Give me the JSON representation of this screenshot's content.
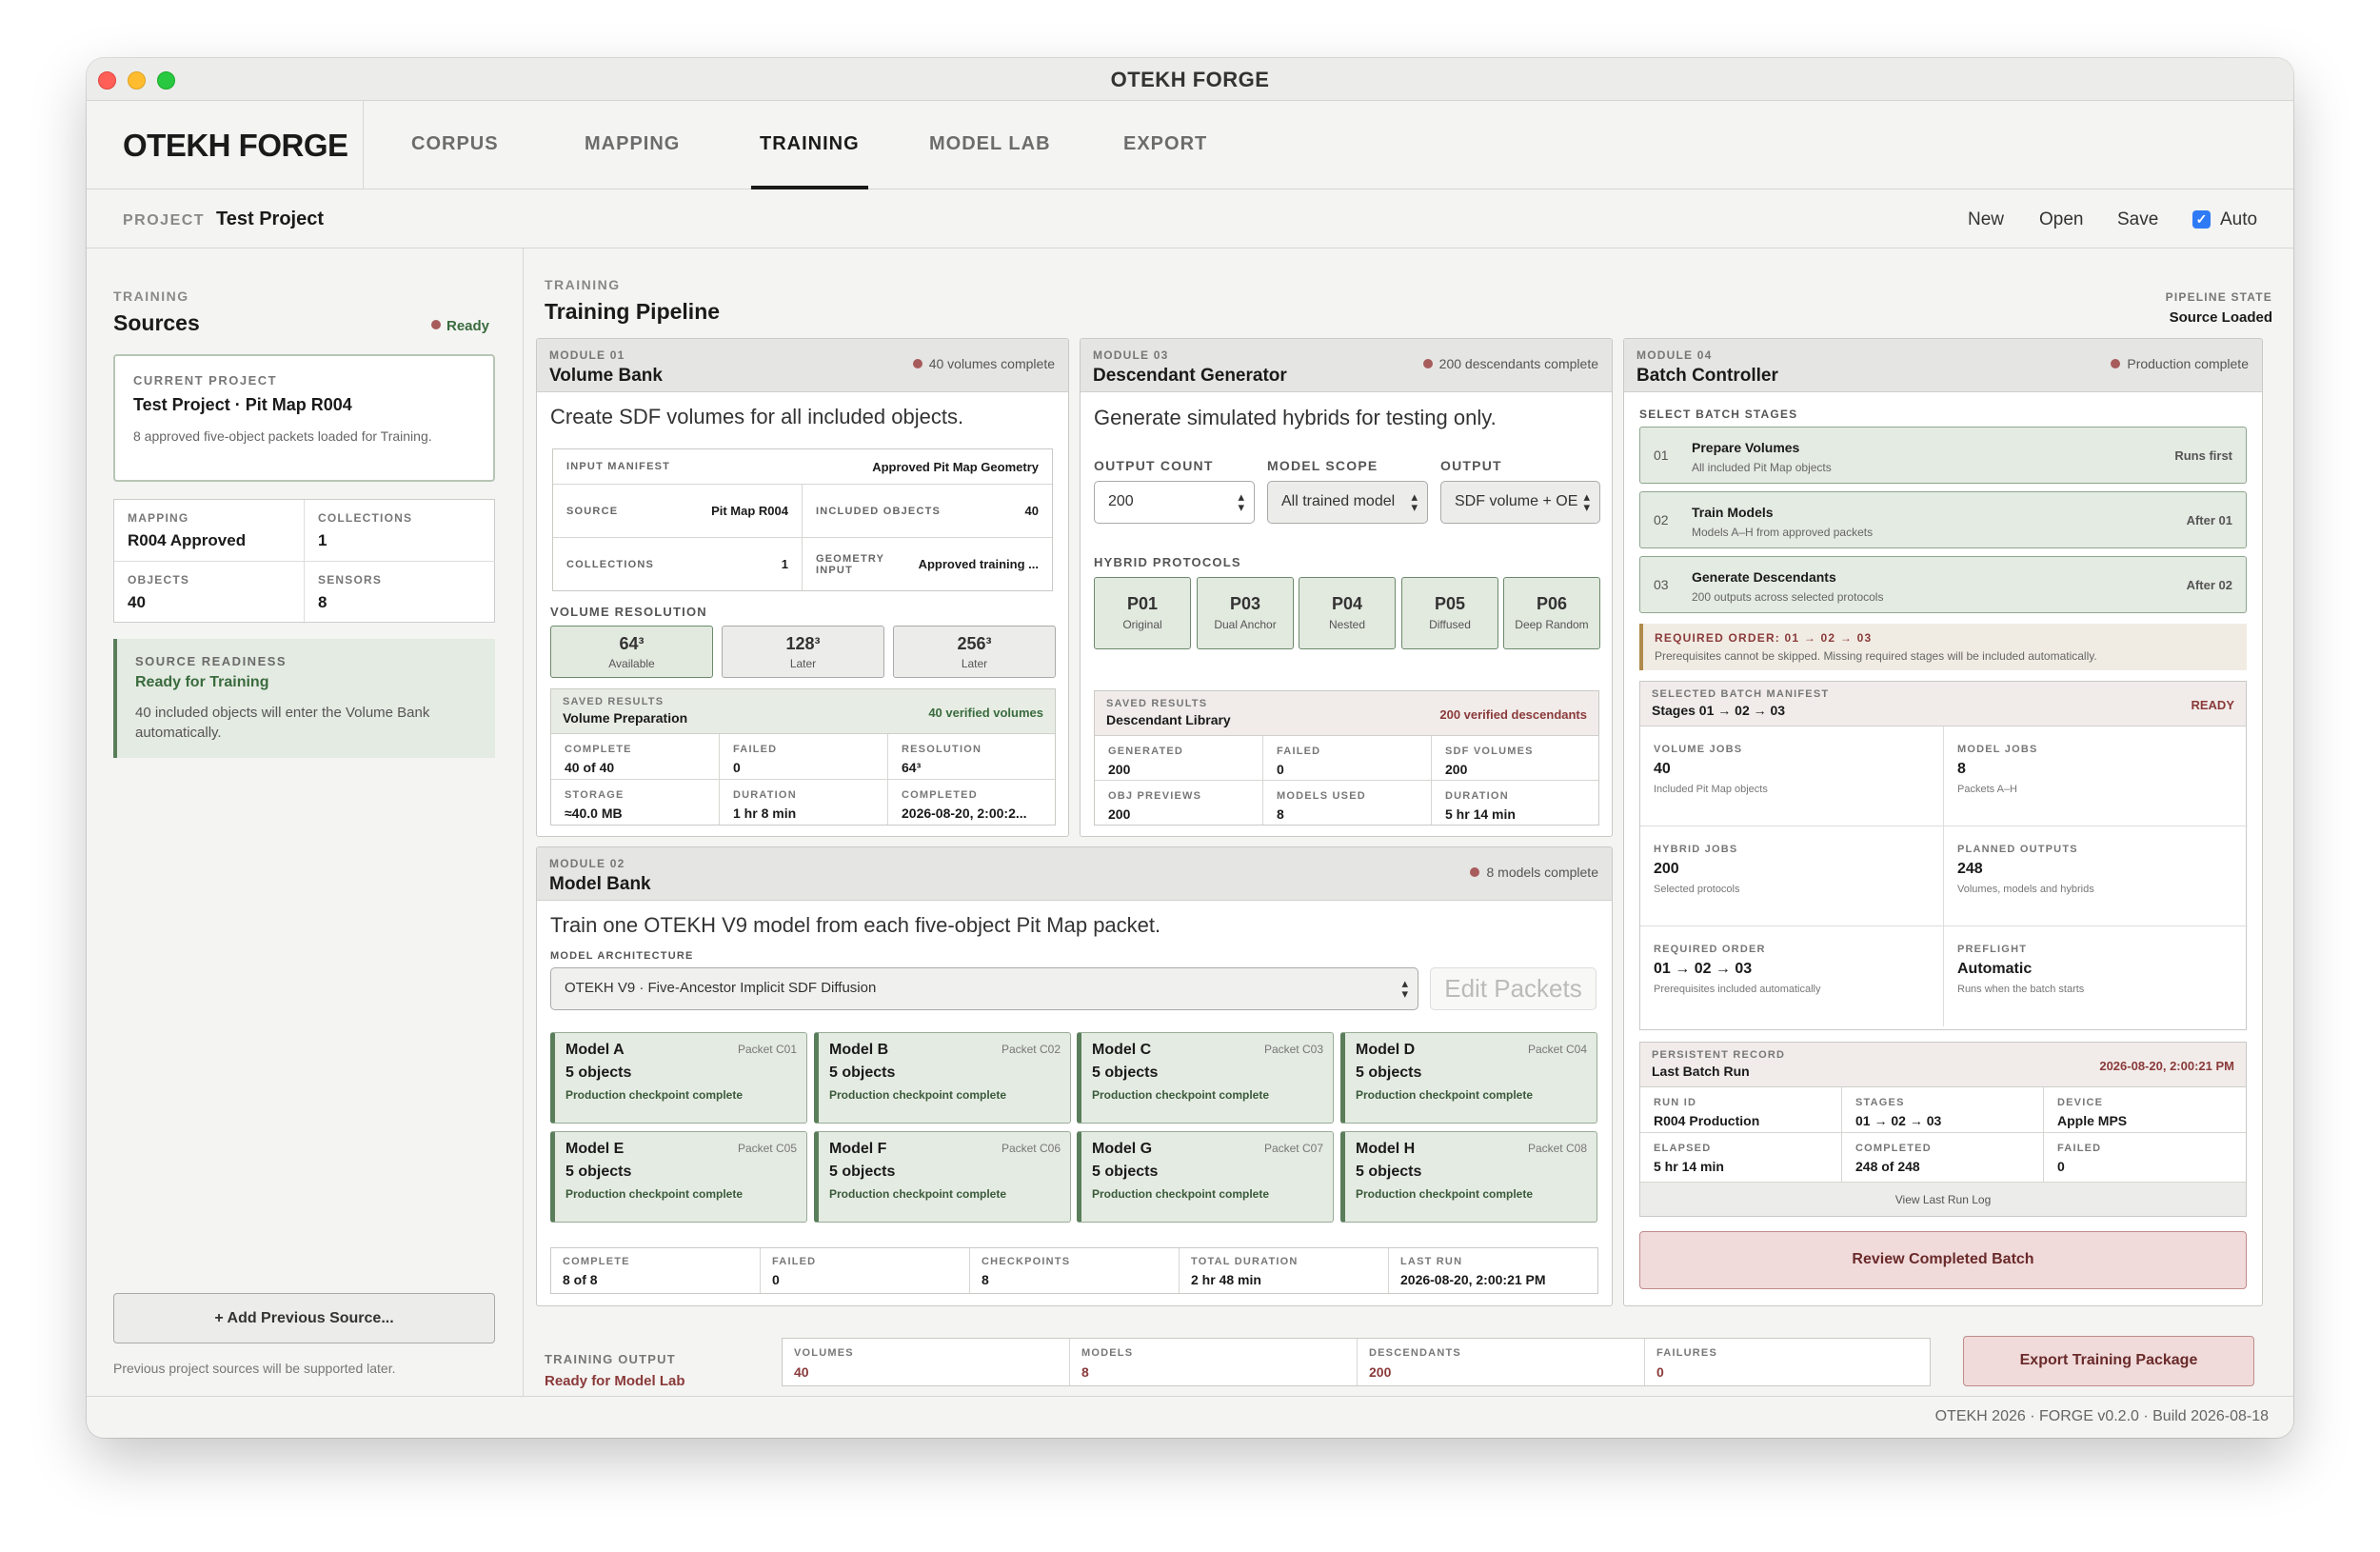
{
  "window": {
    "title": "OTEKH FORGE"
  },
  "brand": "OTEKH FORGE",
  "nav": {
    "tabs": [
      "CORPUS",
      "MAPPING",
      "TRAINING",
      "MODEL LAB",
      "EXPORT"
    ],
    "active": "TRAINING"
  },
  "project": {
    "label": "PROJECT",
    "name": "Test Project",
    "actions": {
      "new": "New",
      "open": "Open",
      "save": "Save",
      "auto": "Auto"
    },
    "auto_checked": true
  },
  "sidebar": {
    "eyebrow": "TRAINING",
    "title": "Sources",
    "status": "Ready",
    "current": {
      "eyebrow": "CURRENT PROJECT",
      "title": "Test Project · Pit Map R004",
      "subtitle": "8 approved five-object packets loaded for Training."
    },
    "stats": [
      {
        "label": "MAPPING",
        "value": "R004 Approved"
      },
      {
        "label": "COLLECTIONS",
        "value": "1"
      },
      {
        "label": "OBJECTS",
        "value": "40"
      },
      {
        "label": "SENSORS",
        "value": "8"
      }
    ],
    "readiness": {
      "eyebrow": "SOURCE READINESS",
      "title": "Ready for Training",
      "text": "40 included objects will enter the Volume Bank automatically."
    },
    "add_button": "+ Add Previous Source...",
    "note": "Previous project sources will be supported later."
  },
  "main": {
    "eyebrow": "TRAINING",
    "title": "Training Pipeline",
    "pipeline_state": {
      "label": "PIPELINE STATE",
      "value": "Source Loaded"
    }
  },
  "module01": {
    "eyebrow": "MODULE 01",
    "title": "Volume Bank",
    "status": "40 volumes complete",
    "desc": "Create SDF volumes for all included objects.",
    "manifest": {
      "label": "INPUT MANIFEST",
      "value": "Approved Pit Map Geometry",
      "source_label": "SOURCE",
      "source_value": "Pit Map R004",
      "included_label": "INCLUDED OBJECTS",
      "included_value": "40",
      "collections_label": "COLLECTIONS",
      "collections_value": "1",
      "geometry_label1": "GEOMETRY",
      "geometry_label2": "INPUT",
      "geometry_value": "Approved training ..."
    },
    "resolution_label": "VOLUME RESOLUTION",
    "resolutions": [
      {
        "value": "64³",
        "status": "Available"
      },
      {
        "value": "128³",
        "status": "Later"
      },
      {
        "value": "256³",
        "status": "Later"
      }
    ],
    "saved": {
      "eyebrow": "SAVED RESULTS",
      "title": "Volume Preparation",
      "right": "40 verified volumes",
      "cells": [
        {
          "label": "COMPLETE",
          "value": "40 of 40"
        },
        {
          "label": "FAILED",
          "value": "0"
        },
        {
          "label": "RESOLUTION",
          "value": "64³"
        },
        {
          "label": "STORAGE",
          "value": "≈40.0 MB"
        },
        {
          "label": "DURATION",
          "value": "1 hr 8 min"
        },
        {
          "label": "COMPLETED",
          "value": "2026-08-20, 2:00:2..."
        }
      ]
    }
  },
  "module03": {
    "eyebrow": "MODULE 03",
    "title": "Descendant Generator",
    "status": "200 descendants complete",
    "desc": "Generate simulated hybrids for testing only.",
    "fields": {
      "count_label": "OUTPUT COUNT",
      "count_value": "200",
      "scope_label": "MODEL SCOPE",
      "scope_value": "All trained model",
      "output_label": "OUTPUT",
      "output_value": "SDF volume + OE"
    },
    "protocols_label": "HYBRID PROTOCOLS",
    "protocols": [
      {
        "code": "P01",
        "name": "Original"
      },
      {
        "code": "P03",
        "name": "Dual Anchor"
      },
      {
        "code": "P04",
        "name": "Nested"
      },
      {
        "code": "P05",
        "name": "Diffused"
      },
      {
        "code": "P06",
        "name": "Deep Random"
      }
    ],
    "saved": {
      "eyebrow": "SAVED RESULTS",
      "title": "Descendant Library",
      "right": "200 verified descendants",
      "cells": [
        {
          "label": "GENERATED",
          "value": "200"
        },
        {
          "label": "FAILED",
          "value": "0"
        },
        {
          "label": "SDF VOLUMES",
          "value": "200"
        },
        {
          "label": "OBJ PREVIEWS",
          "value": "200"
        },
        {
          "label": "MODELS USED",
          "value": "8"
        },
        {
          "label": "DURATION",
          "value": "5 hr 14 min"
        }
      ]
    }
  },
  "module02": {
    "eyebrow": "MODULE 02",
    "title": "Model Bank",
    "status": "8 models complete",
    "desc": "Train one OTEKH V9 model from each five-object Pit Map packet.",
    "arch_label": "MODEL ARCHITECTURE",
    "arch_value": "OTEKH V9 · Five-Ancestor Implicit SDF Diffusion",
    "edit_button": "Edit Packets",
    "models": [
      {
        "name": "Model A",
        "packet": "Packet C01",
        "objects": "5 objects",
        "status": "Production checkpoint complete"
      },
      {
        "name": "Model B",
        "packet": "Packet C02",
        "objects": "5 objects",
        "status": "Production checkpoint complete"
      },
      {
        "name": "Model C",
        "packet": "Packet C03",
        "objects": "5 objects",
        "status": "Production checkpoint complete"
      },
      {
        "name": "Model D",
        "packet": "Packet C04",
        "objects": "5 objects",
        "status": "Production checkpoint complete"
      },
      {
        "name": "Model E",
        "packet": "Packet C05",
        "objects": "5 objects",
        "status": "Production checkpoint complete"
      },
      {
        "name": "Model F",
        "packet": "Packet C06",
        "objects": "5 objects",
        "status": "Production checkpoint complete"
      },
      {
        "name": "Model G",
        "packet": "Packet C07",
        "objects": "5 objects",
        "status": "Production checkpoint complete"
      },
      {
        "name": "Model H",
        "packet": "Packet C08",
        "objects": "5 objects",
        "status": "Production checkpoint complete"
      }
    ],
    "summary": [
      {
        "label": "COMPLETE",
        "value": "8 of 8"
      },
      {
        "label": "FAILED",
        "value": "0"
      },
      {
        "label": "CHECKPOINTS",
        "value": "8"
      },
      {
        "label": "TOTAL DURATION",
        "value": "2 hr 48 min"
      },
      {
        "label": "LAST RUN",
        "value": "2026-08-20, 2:00:21 PM"
      }
    ]
  },
  "module04": {
    "eyebrow": "MODULE 04",
    "title": "Batch Controller",
    "status": "Production complete",
    "stages_label": "SELECT BATCH STAGES",
    "stages": [
      {
        "num": "01",
        "title": "Prepare Volumes",
        "sub": "All included Pit Map objects",
        "right": "Runs first"
      },
      {
        "num": "02",
        "title": "Train Models",
        "sub": "Models A–H from approved packets",
        "right": "After 01"
      },
      {
        "num": "03",
        "title": "Generate Descendants",
        "sub": "200 outputs across selected protocols",
        "right": "After 02"
      }
    ],
    "required": {
      "title": "REQUIRED ORDER: 01 → 02 → 03",
      "text": "Prerequisites cannot be skipped. Missing required stages will be included automatically."
    },
    "manifest": {
      "eyebrow": "SELECTED BATCH MANIFEST",
      "title": "Stages 01 → 02 → 03",
      "right": "READY",
      "cells": [
        {
          "label": "VOLUME JOBS",
          "value": "40",
          "desc": "Included Pit Map objects"
        },
        {
          "label": "MODEL JOBS",
          "value": "8",
          "desc": "Packets A–H"
        },
        {
          "label": "HYBRID JOBS",
          "value": "200",
          "desc": "Selected protocols"
        },
        {
          "label": "PLANNED OUTPUTS",
          "value": "248",
          "desc": "Volumes, models and hybrids"
        },
        {
          "label": "REQUIRED ORDER",
          "value": "01 → 02 → 03",
          "desc": "Prerequisites included automatically"
        },
        {
          "label": "PREFLIGHT",
          "value": "Automatic",
          "desc": "Runs when the batch starts"
        }
      ]
    },
    "record": {
      "eyebrow": "PERSISTENT RECORD",
      "title": "Last Batch Run",
      "right": "2026-08-20, 2:00:21 PM",
      "cells": [
        {
          "label": "RUN ID",
          "value": "R004 Production"
        },
        {
          "label": "STAGES",
          "value": "01 → 02 → 03"
        },
        {
          "label": "DEVICE",
          "value": "Apple MPS"
        },
        {
          "label": "ELAPSED",
          "value": "5 hr 14 min"
        },
        {
          "label": "COMPLETED",
          "value": "248 of 248"
        },
        {
          "label": "FAILED",
          "value": "0"
        }
      ],
      "view_log": "View Last Run Log"
    },
    "review_button": "Review Completed Batch"
  },
  "output": {
    "label": "TRAINING OUTPUT",
    "value": "Ready for Model Lab",
    "cells": [
      {
        "label": "VOLUMES",
        "value": "40"
      },
      {
        "label": "MODELS",
        "value": "8"
      },
      {
        "label": "DESCENDANTS",
        "value": "200"
      },
      {
        "label": "FAILURES",
        "value": "0"
      }
    ],
    "export_button": "Export Training Package"
  },
  "footer": "OTEKH 2026 · FORGE v0.2.0 · Build 2026-08-18",
  "colors": {
    "accent_green": "#5a7e5b",
    "accent_red": "#a85b5b",
    "checkbox_blue": "#2f7bf5"
  }
}
